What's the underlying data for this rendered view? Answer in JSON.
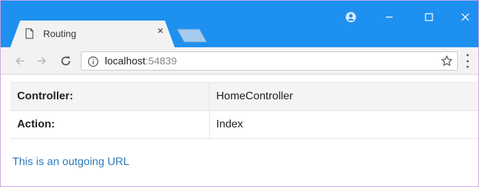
{
  "browser": {
    "tab_title": "Routing",
    "url_host": "localhost",
    "url_port": ":54839"
  },
  "table": {
    "rows": [
      {
        "key": "Controller:",
        "value": "HomeController"
      },
      {
        "key": "Action:",
        "value": "Index"
      }
    ]
  },
  "link": {
    "text": "This is an outgoing URL"
  },
  "colors": {
    "titlebar": "#1e90f0",
    "link": "#2b7bbd"
  }
}
